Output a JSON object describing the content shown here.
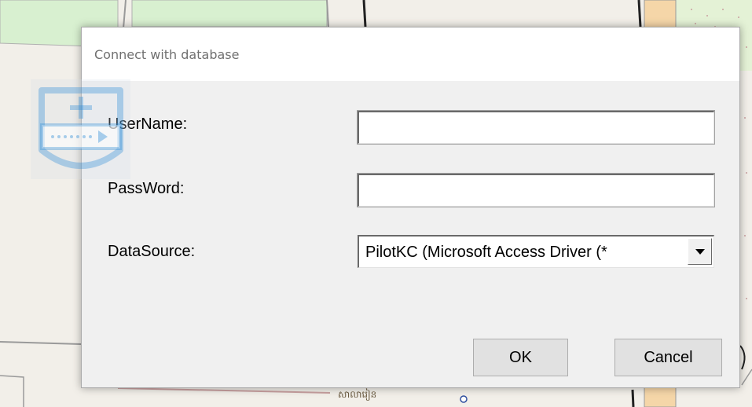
{
  "dialog": {
    "title": "Connect with database",
    "username_label": "UserName:",
    "username_value": "",
    "password_label": "PassWord:",
    "password_value": "",
    "datasource_label": "DataSource:",
    "datasource_value": "PilotKC (Microsoft Access Driver (*",
    "ok_label": "OK",
    "cancel_label": "Cancel"
  },
  "watermark": {
    "icon": "shield-plus-icon"
  },
  "map": {
    "place_label": "សាលារៀន"
  },
  "colors": {
    "dialog_bg": "#f0f0f0",
    "titlebar_bg": "#ffffff",
    "title_text": "#707070",
    "button_bg": "#e1e1e1",
    "map_green": "#d8f0d0",
    "map_orange": "#f5d6a8",
    "watermark_blue": "#2e8bd6"
  }
}
